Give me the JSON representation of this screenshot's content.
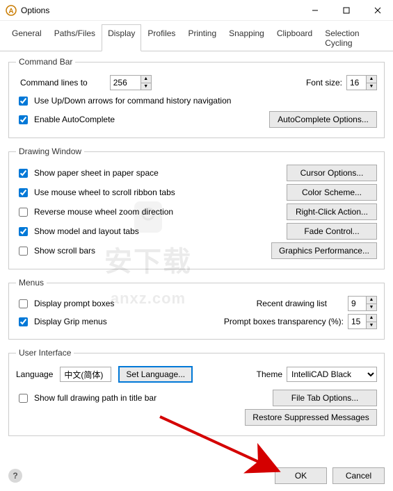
{
  "window": {
    "title": "Options"
  },
  "tabs": {
    "general": "General",
    "paths": "Paths/Files",
    "display": "Display",
    "profiles": "Profiles",
    "printing": "Printing",
    "snapping": "Snapping",
    "clipboard": "Clipboard",
    "selection": "Selection Cycling"
  },
  "commandBar": {
    "legend": "Command Bar",
    "commandLinesTo": "Command lines to",
    "commandLinesValue": "256",
    "fontSizeLabel": "Font size:",
    "fontSizeValue": "16",
    "useArrows": "Use Up/Down arrows for command history navigation",
    "enableAuto": "Enable AutoComplete",
    "autoOptionsBtn": "AutoComplete Options..."
  },
  "drawingWindow": {
    "legend": "Drawing Window",
    "showPaper": "Show paper sheet in paper space",
    "useWheel": "Use mouse wheel to scroll ribbon tabs",
    "reverseWheel": "Reverse mouse wheel zoom direction",
    "showTabs": "Show model and layout tabs",
    "showScroll": "Show scroll bars",
    "cursorBtn": "Cursor Options...",
    "colorBtn": "Color Scheme...",
    "rightClickBtn": "Right-Click Action...",
    "fadeBtn": "Fade Control...",
    "graphicsBtn": "Graphics Performance..."
  },
  "menus": {
    "legend": "Menus",
    "displayPrompt": "Display prompt boxes",
    "displayGrip": "Display Grip menus",
    "recentLabel": "Recent drawing list",
    "recentValue": "9",
    "transparencyLabel": "Prompt boxes transparency (%):",
    "transparencyValue": "15"
  },
  "ui": {
    "legend": "User Interface",
    "languageLabel": "Language",
    "languageValue": "中文(简体)",
    "setLanguageBtn": "Set Language...",
    "themeLabel": "Theme",
    "themeValue": "IntelliCAD Black",
    "showPath": "Show full drawing path in title bar",
    "fileTabBtn": "File Tab Options...",
    "restoreBtn": "Restore Suppressed Messages"
  },
  "footer": {
    "ok": "OK",
    "cancel": "Cancel"
  }
}
